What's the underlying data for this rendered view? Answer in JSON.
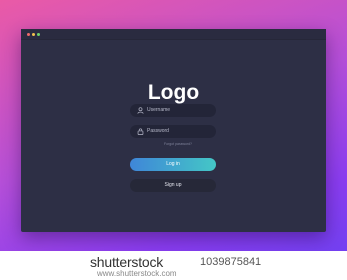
{
  "window": {
    "controls": [
      "close",
      "minimize",
      "maximize"
    ]
  },
  "logo": "Logo",
  "form": {
    "username_placeholder": "Username",
    "password_placeholder": "Password",
    "forgot_label": "Forgot password?",
    "login_label": "Log in",
    "signup_label": "Sign up"
  },
  "watermark": {
    "brand": "shutterstock",
    "id_label": "1039875841",
    "url": "www.shutterstock.com"
  },
  "colors": {
    "background_gradient": [
      "#ea5aa6",
      "#8a3df0"
    ],
    "window": "#2d2f45",
    "input": "#232538",
    "login_gradient": [
      "#3f86d8",
      "#44c7c6"
    ]
  },
  "icons": [
    "user-icon",
    "lock-icon"
  ]
}
